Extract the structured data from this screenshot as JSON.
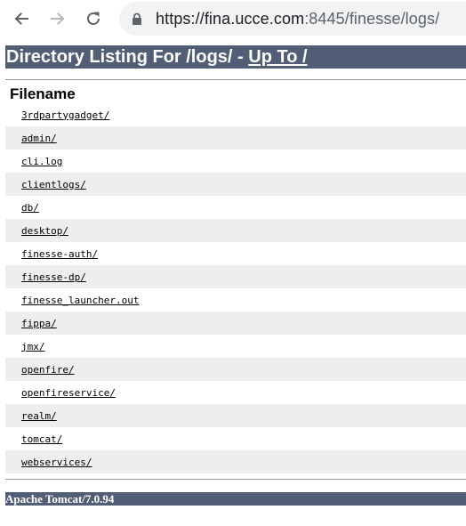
{
  "browser": {
    "url_host": "https://fina.ucce.com",
    "url_rest": ":8445/finesse/logs/"
  },
  "page": {
    "title_prefix": "Directory Listing For /logs/ - ",
    "title_link": "Up To /",
    "column_header": "Filename",
    "files": [
      "3rdpartygadget/",
      "admin/",
      "cli.log",
      "clientlogs/",
      "db/",
      "desktop/",
      "finesse-auth/",
      "finesse-dp/",
      "finesse_launcher.out",
      "fippa/",
      "jmx/",
      "openfire/",
      "openfireservice/",
      "realm/",
      "tomcat/",
      "webservices/"
    ],
    "footer": "Apache Tomcat/7.0.94"
  }
}
